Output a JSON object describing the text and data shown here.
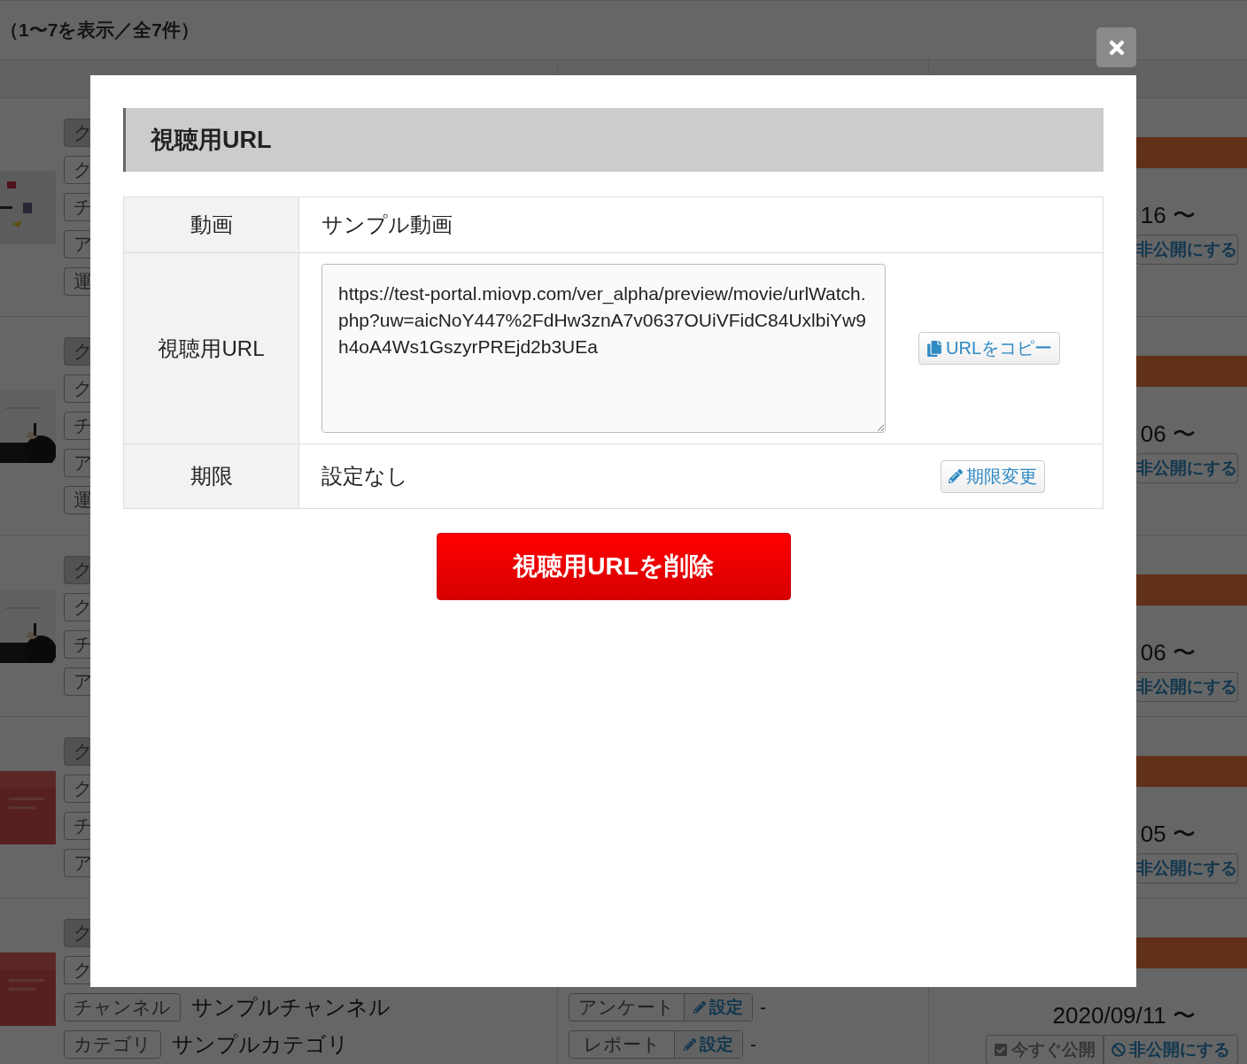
{
  "page": {
    "result_count": "（1〜7を表示／全7件）"
  },
  "rows": [
    {
      "tags": [
        {
          "kind": "status",
          "label": "ク",
          "covered": true
        },
        {
          "kind": "label",
          "label": "ク",
          "covered": true
        },
        {
          "kind": "label",
          "label": "チ",
          "covered": true
        },
        {
          "kind": "label",
          "label": "ア",
          "covered": true
        },
        {
          "kind": "label",
          "label": "運",
          "covered": true
        }
      ],
      "date": "16 〜",
      "unpublish": "非公開にする"
    },
    {
      "tags": [
        {
          "kind": "status",
          "label": "ク",
          "covered": true
        },
        {
          "kind": "label",
          "label": "ク",
          "covered": true
        },
        {
          "kind": "label",
          "label": "チ",
          "covered": true
        },
        {
          "kind": "label",
          "label": "ア",
          "covered": true
        },
        {
          "kind": "label",
          "label": "運",
          "covered": true
        }
      ],
      "date": "06 〜",
      "unpublish": "非公開にする"
    },
    {
      "tags": [
        {
          "kind": "status",
          "label": "ク",
          "covered": true
        },
        {
          "kind": "label",
          "label": "ク",
          "covered": true
        },
        {
          "kind": "label",
          "label": "チ",
          "covered": true
        },
        {
          "kind": "label",
          "label": "ア",
          "covered": true
        }
      ],
      "date": "06 〜",
      "unpublish": "非公開にする"
    },
    {
      "tags": [
        {
          "kind": "status",
          "label": "ク",
          "covered": true
        },
        {
          "kind": "label",
          "label": "ク",
          "covered": true
        },
        {
          "kind": "label",
          "label": "チ",
          "covered": true
        },
        {
          "kind": "label",
          "label": "ア",
          "covered": true
        }
      ],
      "date": "05 〜",
      "unpublish": "非公開にする"
    },
    {
      "tags": [
        {
          "kind": "status",
          "label": "ク",
          "covered": true
        },
        {
          "kind": "label",
          "label": "ク",
          "covered": true
        },
        {
          "kind": "field",
          "label": "チャンネル",
          "value": "サンプルチャンネル",
          "covered": false
        },
        {
          "kind": "field",
          "label": "カテゴリ",
          "value": "サンプルカテゴリ",
          "covered": false
        }
      ],
      "settings": [
        {
          "label": "アンケート",
          "action": "設定",
          "value": "-"
        },
        {
          "label": "レポート",
          "action": "設定",
          "value": "-"
        }
      ],
      "date": "2020/09/11 〜",
      "publish_now": {
        "label": "今すぐ公開",
        "disabled": true
      },
      "unpublish": "非公開にする"
    }
  ],
  "dialog": {
    "title": "視聴用URL",
    "rows": [
      {
        "kind": "text",
        "label": "動画",
        "value": "サンプル動画"
      },
      {
        "kind": "url",
        "label": "視聴用URL",
        "value": "https://test-portal.miovp.com/ver_alpha/preview/movie/urlWatch.php?uw=aicNoY447%2FdHw3znA7v0637OUiVFidC84UxlbiYw9h4oA4Ws1GszyrPREjd2b3UEa",
        "button": "URLをコピー"
      },
      {
        "kind": "text",
        "label": "期限",
        "value": "設定なし",
        "button": "期限変更"
      }
    ],
    "delete_button": "視聴用URLを削除"
  }
}
